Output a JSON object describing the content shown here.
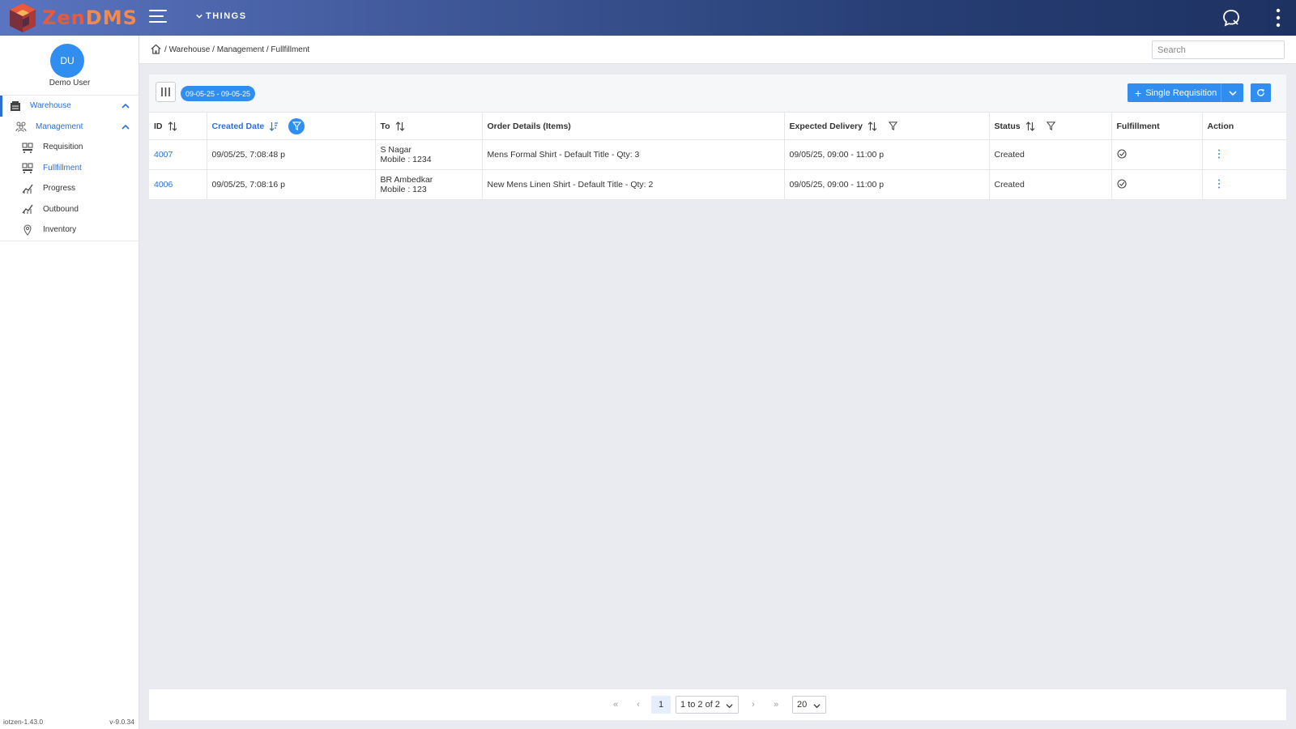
{
  "app": {
    "brand_part1": "Zen",
    "brand_part2": "DMS",
    "menu_label": "THINGS"
  },
  "colors": {
    "accent": "#2f8ef0",
    "link": "#2d6fd1",
    "brand_orange": "#e85a3a"
  },
  "user": {
    "initials": "DU",
    "name": "Demo User"
  },
  "sidebar": {
    "items": [
      {
        "label": "Warehouse",
        "icon": "warehouse-icon"
      },
      {
        "label": "Management",
        "icon": "people-icon"
      },
      {
        "label": "Requisition",
        "icon": "cart-icon"
      },
      {
        "label": "Fullfillment",
        "icon": "cart-icon"
      },
      {
        "label": "Progress",
        "icon": "chart-icon"
      },
      {
        "label": "Outbound",
        "icon": "chart-icon"
      },
      {
        "label": "Inventory",
        "icon": "location-pin-icon"
      }
    ],
    "footer_left": "iotzen-1.43.0",
    "footer_right": "v-9.0.34"
  },
  "breadcrumb": {
    "items": [
      "Warehouse",
      "Management",
      "Fullfillment"
    ]
  },
  "search": {
    "placeholder": "Search"
  },
  "toolbar": {
    "date_range": "09-05-25 - 09-05-25",
    "requisition_label": "Single Requisition"
  },
  "table": {
    "headers": {
      "id": "ID",
      "created": "Created Date",
      "to": "To",
      "order": "Order Details (Items)",
      "expected": "Expected Delivery",
      "status": "Status",
      "fulfillment": "Fulfillment",
      "action": "Action"
    },
    "rows": [
      {
        "id": "4007",
        "created": "09/05/25, 7:08:48 p",
        "to_name": "S Nagar",
        "to_mobile": "Mobile : 1234",
        "order": "Mens Formal Shirt - Default Title - Qty: 3",
        "expected": "09/05/25, 09:00 - 11:00 p",
        "status": "Created"
      },
      {
        "id": "4006",
        "created": "09/05/25, 7:08:16 p",
        "to_name": "BR Ambedkar",
        "to_mobile": "Mobile : 123",
        "order": "New Mens Linen Shirt - Default Title - Qty: 2",
        "expected": "09/05/25, 09:00 - 11:00 p",
        "status": "Created"
      }
    ]
  },
  "pagination": {
    "first": "«",
    "prev": "‹",
    "page": "1",
    "range": "1 to 2 of 2",
    "next": "›",
    "last": "»",
    "page_size": "20"
  }
}
